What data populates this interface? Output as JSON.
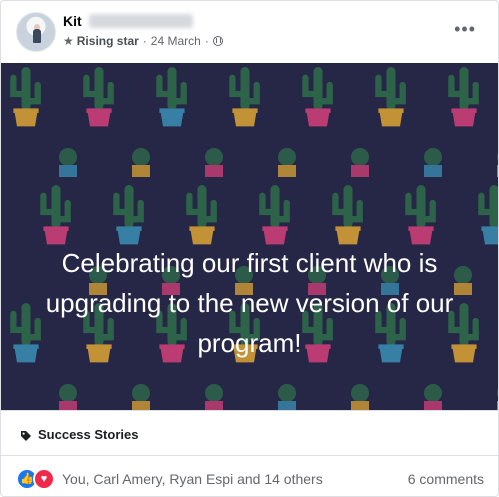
{
  "post": {
    "author": "Kit",
    "badge": "Rising star",
    "date": "24 March",
    "audience_icon": "public-globe-icon",
    "more_label": "•••",
    "message": "Celebrating our first client who is upgrading to the new version of our program!",
    "background_color": "#262747",
    "topic_tag": "Success Stories"
  },
  "reactions": {
    "types": [
      "like-icon",
      "love-icon"
    ],
    "summary": "You, Carl Amery, Ryan Espi and 14 others",
    "comments": "6 comments"
  }
}
